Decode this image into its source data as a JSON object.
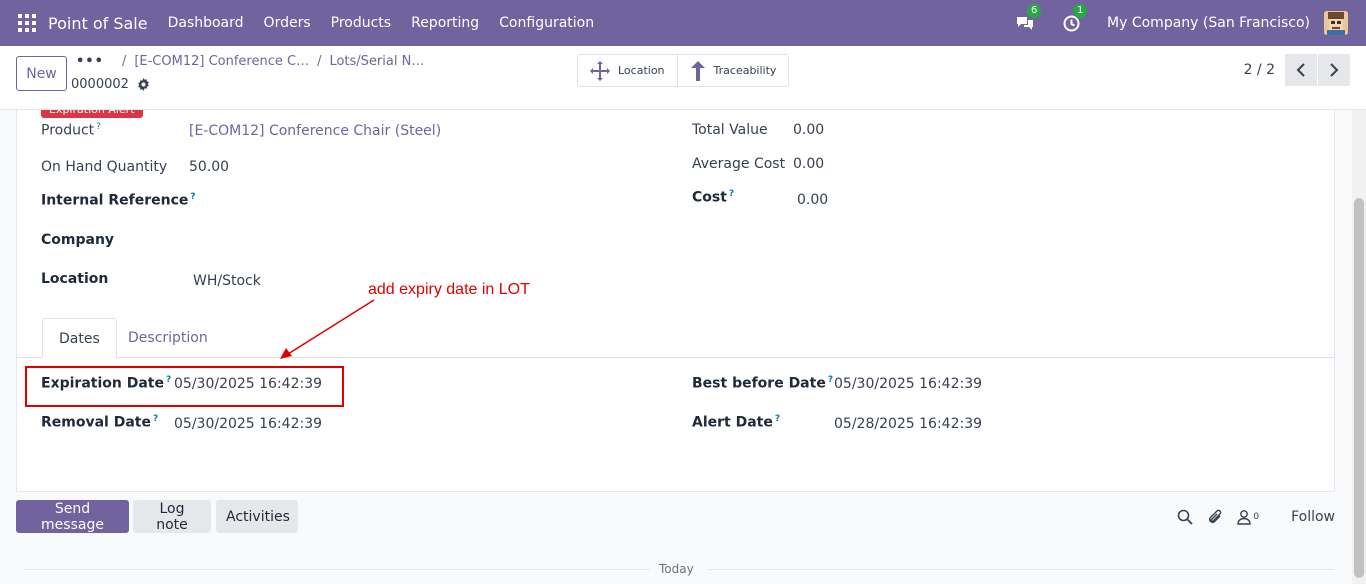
{
  "navbar": {
    "app_title": "Point of Sale",
    "menu": [
      "Dashboard",
      "Orders",
      "Products",
      "Reporting",
      "Configuration"
    ],
    "messages_count": "6",
    "activities_count": "1",
    "company": "My Company (San Francisco)",
    "accent_color": "#71639e"
  },
  "control_panel": {
    "new_label": "New",
    "breadcrumb_dots": "•••",
    "breadcrumb_1": "[E-COM12] Conference C…",
    "breadcrumb_2": "Lots/Serial N…",
    "record_name": "0000002",
    "smart_buttons": {
      "location": "Location",
      "traceability": "Traceability"
    },
    "pager_value": "2 / 2"
  },
  "form": {
    "ribbon": "Expiration Alert",
    "product_label": "Product",
    "product_value": "[E-COM12] Conference Chair (Steel)",
    "on_hand_label": "On Hand Quantity",
    "on_hand_value": "50.00",
    "internal_ref_label": "Internal Reference",
    "company_label": "Company",
    "location_label": "Location",
    "location_value": "WH/Stock",
    "total_value_label": "Total Value",
    "total_value_value": "0.00",
    "avg_cost_label": "Average Cost",
    "avg_cost_value": "0.00",
    "cost_label": "Cost",
    "cost_value": "0.00",
    "help_mark": "?",
    "tabs": [
      "Dates",
      "Description"
    ],
    "expiration_label": "Expiration Date",
    "expiration_value": "05/30/2025 16:42:39",
    "removal_label": "Removal Date",
    "removal_value": "05/30/2025 16:42:39",
    "best_before_label": "Best before Date",
    "best_before_value": "05/30/2025 16:42:39",
    "alert_label": "Alert Date",
    "alert_value": "05/28/2025 16:42:39"
  },
  "annotation": {
    "text": "add expiry date in LOT",
    "color": "#e00000"
  },
  "chatter": {
    "send_message": "Send message",
    "log_note": "Log note",
    "activities": "Activities",
    "followers_count": "0",
    "follow": "Follow",
    "today": "Today"
  }
}
